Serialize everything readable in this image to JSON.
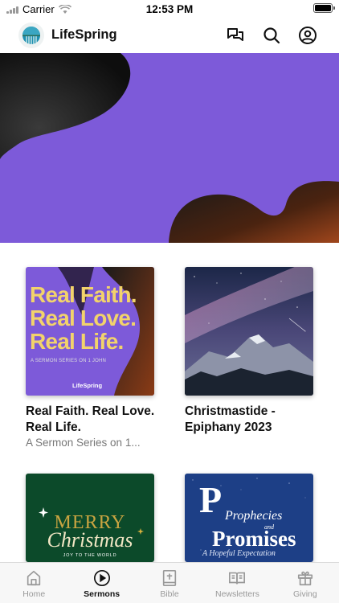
{
  "status_bar": {
    "carrier": "Carrier",
    "time": "12:53 PM"
  },
  "header": {
    "app_name": "LifeSpring"
  },
  "sermons": [
    {
      "title": "Real Faith. Real Love. Real Life.",
      "subtitle": "A Sermon Series on 1...",
      "art": {
        "lines": [
          "Real Faith.",
          "Real Love.",
          "Real Life."
        ],
        "tagline": "A SERMON SERIES ON 1 JOHN",
        "brand": "LifeSpring"
      }
    },
    {
      "title": "Christmastide - Epiphany 2023",
      "subtitle": ""
    },
    {
      "title": "",
      "subtitle": "",
      "art": {
        "line1": "MERRY",
        "line2": "Christmas",
        "tagline": "JOY TO THE WORLD"
      }
    },
    {
      "title": "",
      "subtitle": "",
      "art": {
        "line1": "Prophecies",
        "line2": "and",
        "line3": "Promises",
        "line4": "A Hopeful Expectation"
      }
    }
  ],
  "tabs": [
    {
      "label": "Home",
      "icon": "home-icon",
      "active": false
    },
    {
      "label": "Sermons",
      "icon": "play-circle-icon",
      "active": true
    },
    {
      "label": "Bible",
      "icon": "bible-icon",
      "active": false
    },
    {
      "label": "Newsletters",
      "icon": "newsletter-icon",
      "active": false
    },
    {
      "label": "Giving",
      "icon": "gift-icon",
      "active": false
    }
  ],
  "colors": {
    "hero": "#7d5ad9",
    "active_tab": "#111111",
    "inactive_tab": "#999999"
  }
}
